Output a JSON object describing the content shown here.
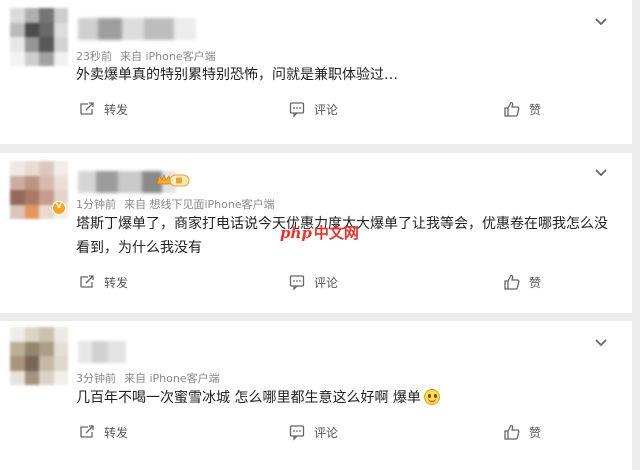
{
  "comments": [
    {
      "time": "23秒前",
      "source": "来自 iPhone客户端",
      "text": "外卖爆单真的特别累特别恐怖，问就是兼职体验过…",
      "actions": {
        "repost": "转发",
        "comment": "评论",
        "like": "赞"
      }
    },
    {
      "time": "1分钟前",
      "source": "来自 想线下见面iPhone客户端",
      "text_line1": "塔斯丁爆单了，商家打电话说今天优惠力度太大爆单了让我等会，优惠卷在哪我怎么没",
      "text_line2": "看到，为什么我没有",
      "actions": {
        "repost": "转发",
        "comment": "评论",
        "like": "赞"
      }
    },
    {
      "time": "3分钟前",
      "source": "来自 iPhone客户端",
      "text": "几百年不喝一次蜜雪冰城 怎么哪里都生意这么好啊 爆单",
      "actions": {
        "repost": "转发",
        "comment": "评论",
        "like": "赞"
      }
    }
  ],
  "watermark": {
    "php": "php",
    "cn": "中文网"
  },
  "icons": {
    "expand": "chevron-down-icon",
    "repost": "repost-icon",
    "comment": "comment-icon",
    "like": "thumbs-up-icon",
    "emoji": "smile-emoji-icon"
  },
  "colors": {
    "meta": "#888888",
    "text": "#222222",
    "watermark": "#e2362f"
  }
}
